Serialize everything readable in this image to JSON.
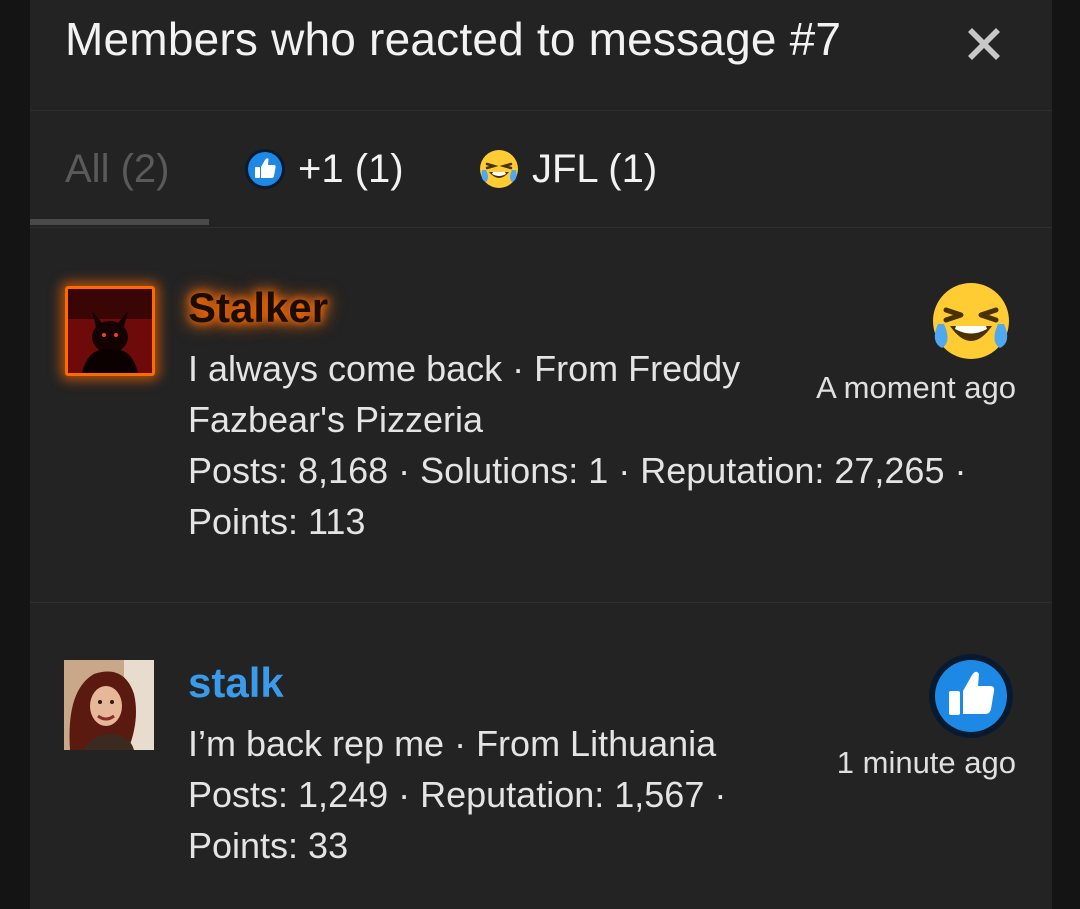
{
  "modal": {
    "title": "Members who reacted to message #7",
    "close_icon": "close-icon"
  },
  "tabs": [
    {
      "label": "All (2)",
      "active": true
    },
    {
      "label": "+1 (1)",
      "icon": "thumbs-up-icon"
    },
    {
      "label": "JFL (1)",
      "icon": "laughing-crying-face-icon"
    }
  ],
  "members": [
    {
      "name": "Stalker",
      "name_color": "#ff6a00",
      "info_lines": [
        "I always come back · From Freddy",
        "Fazbear's Pizzeria",
        "Posts: 8,168 · Solutions: 1 · Reputation: 27,265 ·",
        "Points: 113"
      ],
      "reaction_icon": "laughing-crying-face-icon",
      "time": "A moment ago"
    },
    {
      "name": "stalk",
      "name_color": "#3a9bea",
      "info_lines": [
        "I’m back rep me · From Lithuania",
        "Posts: 1,249 · Reputation: 1,567 ·",
        "Points: 33"
      ],
      "reaction_icon": "thumbs-up-icon",
      "time": "1 minute ago"
    }
  ],
  "colors": {
    "background": "#232323",
    "accent_blue": "#1e88e5",
    "emoji_yellow": "#ffcc33"
  }
}
